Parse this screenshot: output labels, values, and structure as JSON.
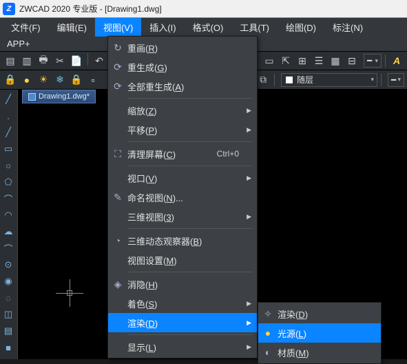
{
  "title": "ZWCAD 2020 专业版 - [Drawing1.dwg]",
  "menubar": [
    "文件(F)",
    "编辑(E)",
    "视图(V)",
    "插入(I)",
    "格式(O)",
    "工具(T)",
    "绘图(D)",
    "标注(N)"
  ],
  "menubar_row2": "APP+",
  "doc_tab": "Drawing1.dwg*",
  "layer_combo": "随层",
  "view_menu": {
    "items": [
      {
        "icon": "↻",
        "label": "重画(<u>R</u>)"
      },
      {
        "icon": "⟳",
        "label": "重生成(<u>G</u>)"
      },
      {
        "icon": "⟳",
        "label": "全部重生成(<u>A</u>)"
      },
      {
        "sep": true
      },
      {
        "label": "缩放(<u>Z</u>)",
        "sub": true
      },
      {
        "label": "平移(<u>P</u>)",
        "sub": true
      },
      {
        "sep": true
      },
      {
        "icon": "⛶",
        "label": "清理屏幕(<u>C</u>)",
        "shortcut": "Ctrl+0"
      },
      {
        "sep": true
      },
      {
        "label": "视口(<u>V</u>)",
        "sub": true
      },
      {
        "icon": "✎",
        "label": "命名视图(<u>N</u>)..."
      },
      {
        "label": "三维视图(<u>3</u>)",
        "sub": true
      },
      {
        "sep": true
      },
      {
        "icon": "◔",
        "label": "三维动态观察器(<u>B</u>)"
      },
      {
        "label": "视图设置(<u>M</u>)"
      },
      {
        "sep": true
      },
      {
        "icon": "◈",
        "label": "消隐(<u>H</u>)"
      },
      {
        "label": "着色(<u>S</u>)",
        "sub": true
      },
      {
        "label": "渲染(<u>D</u>)",
        "sub": true,
        "hl": true
      },
      {
        "sep": true
      },
      {
        "label": "显示(<u>L</u>)",
        "sub": true
      }
    ]
  },
  "render_submenu": {
    "items": [
      {
        "icon": "✧",
        "label": "渲染(<u>D</u>)"
      },
      {
        "icon": "●",
        "iconcls": "bulb",
        "label": "光源(<u>L</u>)",
        "hl": true
      },
      {
        "icon": "◐",
        "label": "材质(<u>M</u>)"
      }
    ]
  },
  "toolbar1_icons": [
    "▤",
    "▥",
    "🖶",
    "✂",
    "📄",
    "↶",
    "↷",
    "",
    "⌖",
    "▦",
    "▭",
    "⇱",
    "⊞",
    "☰",
    "▦",
    "⊟",
    "",
    "A"
  ],
  "toolbar2_icons": [
    "⌂",
    "●",
    "☀",
    "❄",
    "🔒",
    "▫",
    "▫",
    "",
    "⧉"
  ],
  "left_tool_icons": [
    "╱",
    ".",
    "╱",
    "▭",
    "○",
    "⬠",
    "⌒",
    "◠",
    "☁",
    "⌒",
    "⊙",
    "◉",
    "◌",
    "◫",
    "▤",
    "■"
  ]
}
